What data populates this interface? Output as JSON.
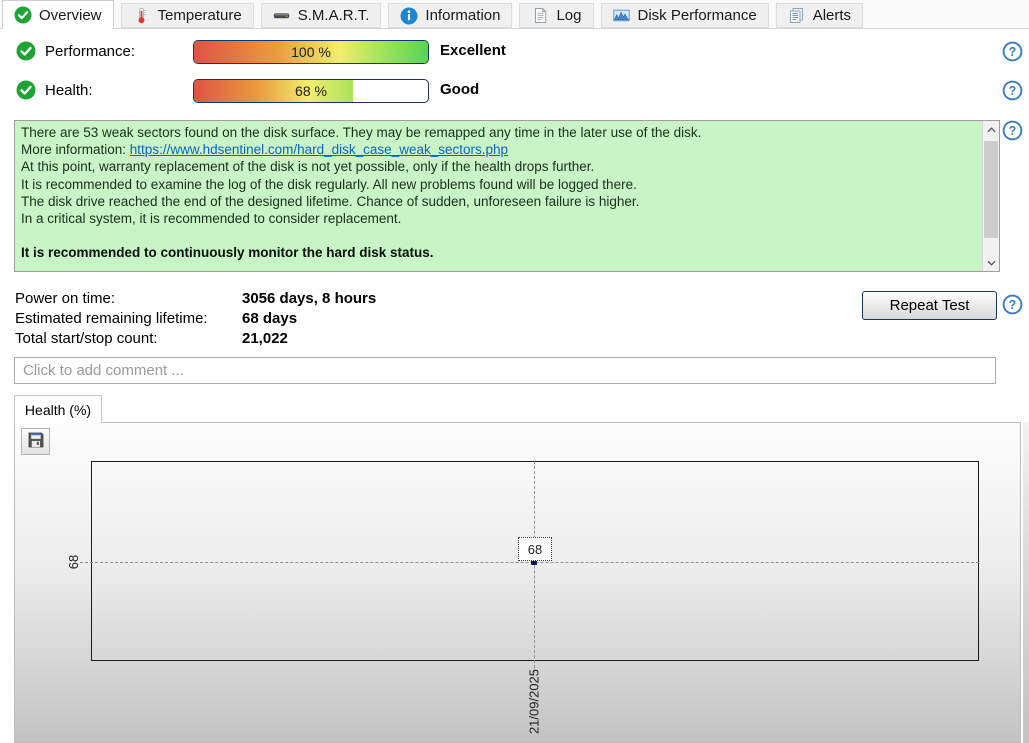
{
  "tabs": [
    {
      "label": "Overview",
      "icon": "check-circle-icon",
      "active": true
    },
    {
      "label": "Temperature",
      "icon": "thermometer-icon",
      "active": false
    },
    {
      "label": "S.M.A.R.T.",
      "icon": "disk-drive-icon",
      "active": false
    },
    {
      "label": "Information",
      "icon": "info-icon",
      "active": false
    },
    {
      "label": "Log",
      "icon": "log-document-icon",
      "active": false
    },
    {
      "label": "Disk Performance",
      "icon": "performance-chart-icon",
      "active": false
    },
    {
      "label": "Alerts",
      "icon": "alerts-pages-icon",
      "active": false
    }
  ],
  "status_rows": [
    {
      "label": "Performance:",
      "value_text": "100 %",
      "pct": 100,
      "rating": "Excellent"
    },
    {
      "label": "Health:",
      "value_text": "68 %",
      "pct": 68,
      "rating": "Good"
    }
  ],
  "message_box": {
    "line1": "There are 53 weak sectors found on the disk surface. They may be remapped any time in the later use of the disk.",
    "more_info_prefix": "More information: ",
    "link_text": "https://www.hdsentinel.com/hard_disk_case_weak_sectors.php",
    "line3": "At this point, warranty replacement of the disk is not yet possible, only if the health drops further.",
    "line4": "It is recommended to examine the log of the disk regularly. All new problems found will be logged there.",
    "line5": "The disk drive reached the end of the designed lifetime. Chance of sudden, unforeseen failure is higher.",
    "line6": "In a critical system, it is recommended to consider replacement.",
    "bold_line": "It is recommended to continuously monitor the hard disk status."
  },
  "stats": [
    {
      "label": "Power on time:",
      "value": "3056 days, 8 hours"
    },
    {
      "label": "Estimated remaining lifetime:",
      "value": "68 days"
    },
    {
      "label": "Total start/stop count:",
      "value": "21,022"
    }
  ],
  "buttons": {
    "repeat_test": "Repeat Test"
  },
  "comment": {
    "placeholder": "Click to add comment ..."
  },
  "chart_tab": {
    "label": "Health (%)"
  },
  "chart_data": {
    "type": "line",
    "title": "Health (%)",
    "x": [
      "21/09/2025"
    ],
    "values": [
      68
    ],
    "y_axis_ticks": [
      "68"
    ],
    "point_labels": [
      "68"
    ],
    "ylim": [
      0,
      100
    ],
    "xlabel": "",
    "ylabel": "",
    "legend": "none",
    "grid": "dashed crosshair through the single data point"
  },
  "icons": {
    "question_glyph": "?",
    "info_glyph": "i"
  },
  "colors": {
    "meter_border": "#17365d",
    "meter_gradient": [
      "#df5345",
      "#ea9b3e",
      "#f1ee6c",
      "#55d353"
    ],
    "message_bg": "#c9f4c5",
    "link": "#0b63c5",
    "help_blue": "#3c7dc0",
    "ok_green": "#1ea434",
    "panel_gradient_top": "#fdfdfd",
    "panel_gradient_bottom": "#c3c3c3",
    "datapoint": "#121258"
  }
}
